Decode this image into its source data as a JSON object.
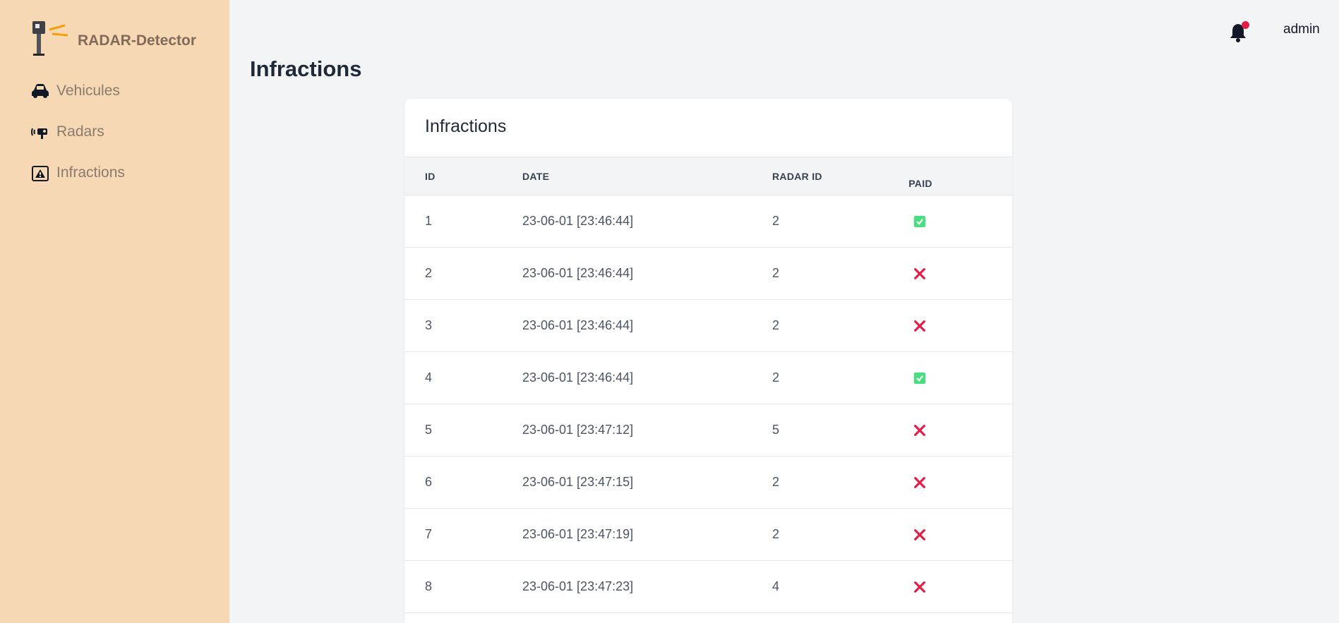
{
  "brand": {
    "name": "RADAR-Detector"
  },
  "sidebar": {
    "items": [
      {
        "label": "Vehicules",
        "icon": "car-icon"
      },
      {
        "label": "Radars",
        "icon": "radar-camera-icon"
      },
      {
        "label": "Infractions",
        "icon": "warning-ticket-icon"
      }
    ]
  },
  "topbar": {
    "user": "admin",
    "notification_icon": "bell-icon"
  },
  "page": {
    "title": "Infractions"
  },
  "card": {
    "title": "Infractions"
  },
  "table": {
    "headers": [
      "ID",
      "DATE",
      "RADAR ID",
      "PAID"
    ],
    "rows": [
      {
        "id": "1",
        "date": "23-06-01 [23:46:44]",
        "radar_id": "2",
        "paid": true
      },
      {
        "id": "2",
        "date": "23-06-01 [23:46:44]",
        "radar_id": "2",
        "paid": false
      },
      {
        "id": "3",
        "date": "23-06-01 [23:46:44]",
        "radar_id": "2",
        "paid": false
      },
      {
        "id": "4",
        "date": "23-06-01 [23:46:44]",
        "radar_id": "2",
        "paid": true
      },
      {
        "id": "5",
        "date": "23-06-01 [23:47:12]",
        "radar_id": "5",
        "paid": false
      },
      {
        "id": "6",
        "date": "23-06-01 [23:47:15]",
        "radar_id": "2",
        "paid": false
      },
      {
        "id": "7",
        "date": "23-06-01 [23:47:19]",
        "radar_id": "2",
        "paid": false
      },
      {
        "id": "8",
        "date": "23-06-01 [23:47:23]",
        "radar_id": "4",
        "paid": false
      }
    ]
  },
  "colors": {
    "sidebar_bg": "#f6d9b4",
    "paid_true": "#4ade80",
    "paid_false": "#e11d48",
    "bell_dot": "#e11d48"
  }
}
